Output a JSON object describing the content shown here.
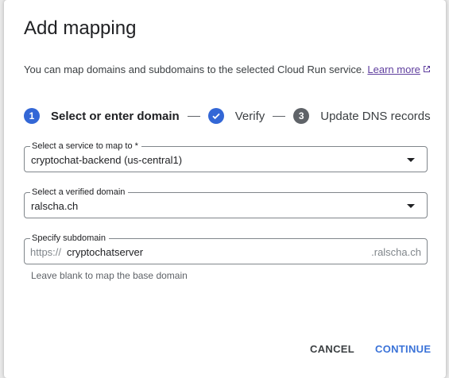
{
  "dialog": {
    "title": "Add mapping",
    "description": "You can map domains and subdomains to the selected Cloud Run service.",
    "learn_more": "Learn more"
  },
  "stepper": {
    "steps": [
      {
        "number": "1",
        "label": "Select or enter domain",
        "state": "active"
      },
      {
        "number": "",
        "label": "Verify",
        "state": "done"
      },
      {
        "number": "3",
        "label": "Update DNS records",
        "state": "todo"
      }
    ]
  },
  "service_field": {
    "label": "Select a service to map to *",
    "value": "cryptochat-backend (us-central1)"
  },
  "domain_field": {
    "label": "Select a verified domain",
    "value": "ralscha.ch"
  },
  "subdomain_field": {
    "label": "Specify subdomain",
    "prefix": "https://",
    "value": "cryptochatserver",
    "suffix": ".ralscha.ch",
    "hint": "Leave blank to map the base domain"
  },
  "actions": {
    "cancel": "CANCEL",
    "continue": "CONTINUE"
  },
  "colors": {
    "accent": "#3367d6",
    "continue_text": "#3b73d8",
    "link": "#5f3e9e"
  },
  "icons": {
    "external_link": "external-link-icon",
    "check": "check-icon",
    "dropdown": "arrow-drop-down-icon"
  }
}
